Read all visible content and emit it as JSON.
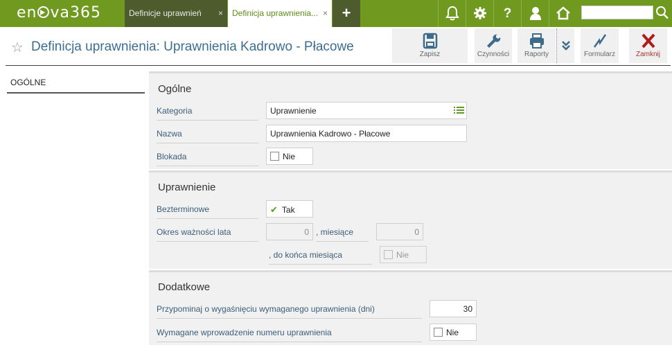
{
  "app": {
    "logo_left": "en",
    "logo_right": "va365"
  },
  "tabs": [
    {
      "label": "Definicje uprawnień",
      "close": "×"
    },
    {
      "label": "Definicja uprawnienia...",
      "close": "×"
    }
  ],
  "topbar": {
    "plus": "+",
    "help": "?",
    "search_placeholder": ""
  },
  "header": {
    "star": "☆",
    "title": "Definicja uprawnienia: Uprawnienia Kadrowo - Płacowe"
  },
  "toolbar": {
    "save": "Zapisz",
    "actions": "Czynności",
    "reports": "Raporty",
    "form": "Formularz",
    "close": "Zamknij"
  },
  "nav": {
    "general": "OGÓLNE"
  },
  "sections": {
    "ogolne": {
      "title": "Ogólne",
      "kategoria_label": "Kategoria",
      "kategoria_value": "Uprawnienie",
      "nazwa_label": "Nazwa",
      "nazwa_value": "Uprawnienia Kadrowo - Płacowe",
      "blokada_label": "Blokada",
      "blokada_value": "Nie"
    },
    "uprawnienie": {
      "title": "Uprawnienie",
      "bezterminowe_label": "Bezterminowe",
      "bezterminowe_value": "Tak",
      "okres_label": "Okres ważności lata",
      "lata_value": "0",
      "miesiace_label": ", miesiące",
      "miesiace_value": "0",
      "do_konca_label": ", do końca miesiąca",
      "do_konca_value": "Nie"
    },
    "dodatkowe": {
      "title": "Dodatkowe",
      "przypominaj_label": "Przypominaj o wygaśnięciu wymaganego uprawnienia (dni)",
      "przypominaj_value": "30",
      "wymagane_label": "Wymagane wprowadzenie numeru uprawnienia",
      "wymagane_value": "Nie"
    }
  }
}
